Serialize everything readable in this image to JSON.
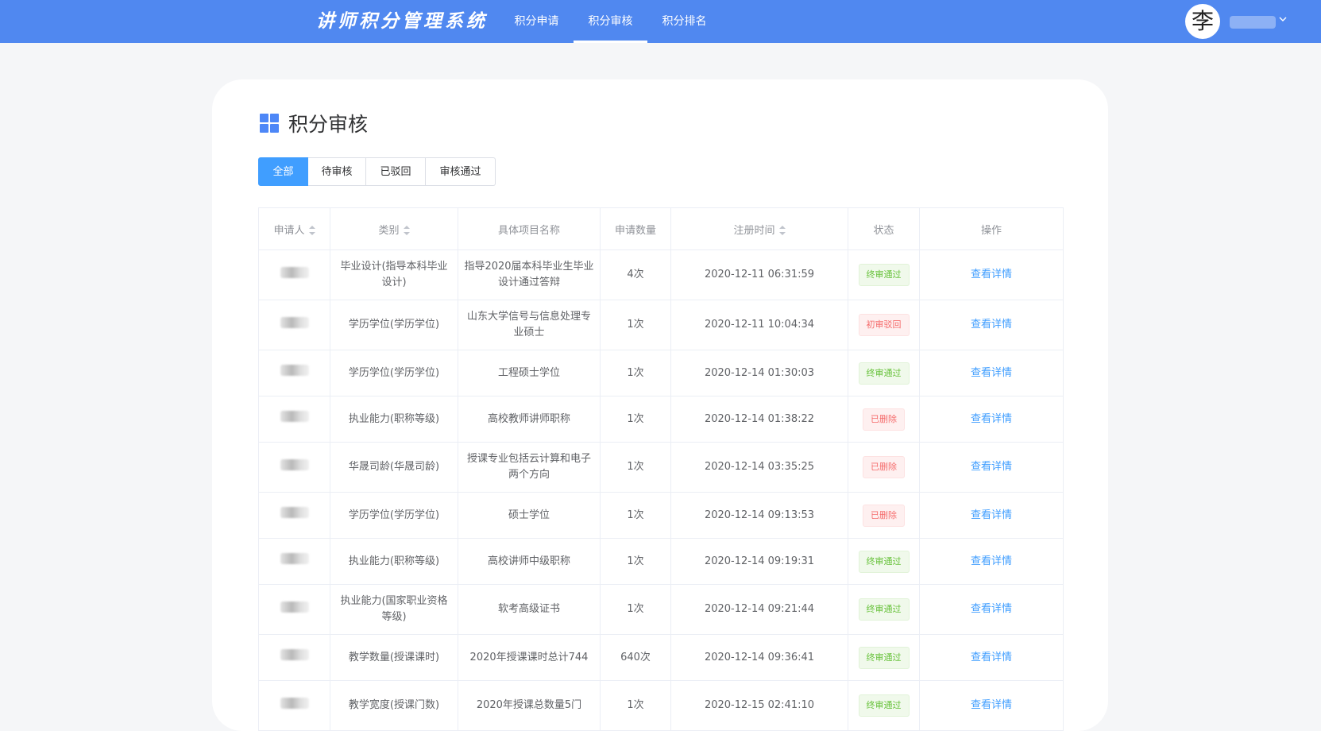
{
  "header": {
    "logo": "讲师积分管理系统",
    "nav": [
      {
        "label": "积分申请",
        "active": false
      },
      {
        "label": "积分审核",
        "active": true
      },
      {
        "label": "积分排名",
        "active": false
      }
    ],
    "avatar": "李",
    "user_menu_icon": "chevron-down-icon"
  },
  "page": {
    "title": "积分审核",
    "title_icon": "grid-icon"
  },
  "tabs": [
    {
      "label": "全部",
      "active": true
    },
    {
      "label": "待审核",
      "active": false
    },
    {
      "label": "已驳回",
      "active": false
    },
    {
      "label": "审核通过",
      "active": false
    }
  ],
  "table": {
    "columns": [
      "申请人",
      "类别",
      "具体项目名称",
      "申请数量",
      "注册时间",
      "状态",
      "操作"
    ],
    "rows": [
      {
        "category": "毕业设计(指导本科毕业设计)",
        "project": "指导2020届本科毕业生毕业设计通过答辩",
        "count": "4次",
        "time": "2020-12-11 06:31:59",
        "status": "终审通过",
        "status_type": "success",
        "action": "查看详情"
      },
      {
        "category": "学历学位(学历学位)",
        "project": "山东大学信号与信息处理专业硕士",
        "count": "1次",
        "time": "2020-12-11 10:04:34",
        "status": "初审驳回",
        "status_type": "danger",
        "action": "查看详情"
      },
      {
        "category": "学历学位(学历学位)",
        "project": "工程硕士学位",
        "count": "1次",
        "time": "2020-12-14 01:30:03",
        "status": "终审通过",
        "status_type": "success",
        "action": "查看详情"
      },
      {
        "category": "执业能力(职称等级)",
        "project": "高校教师讲师职称",
        "count": "1次",
        "time": "2020-12-14 01:38:22",
        "status": "已删除",
        "status_type": "danger",
        "action": "查看详情"
      },
      {
        "category": "华晟司龄(华晟司龄)",
        "project": "授课专业包括云计算和电子两个方向",
        "count": "1次",
        "time": "2020-12-14 03:35:25",
        "status": "已删除",
        "status_type": "danger",
        "action": "查看详情"
      },
      {
        "category": "学历学位(学历学位)",
        "project": "硕士学位",
        "count": "1次",
        "time": "2020-12-14 09:13:53",
        "status": "已删除",
        "status_type": "danger",
        "action": "查看详情"
      },
      {
        "category": "执业能力(职称等级)",
        "project": "高校讲师中级职称",
        "count": "1次",
        "time": "2020-12-14 09:19:31",
        "status": "终审通过",
        "status_type": "success",
        "action": "查看详情"
      },
      {
        "category": "执业能力(国家职业资格等级)",
        "project": "软考高级证书",
        "count": "1次",
        "time": "2020-12-14 09:21:44",
        "status": "终审通过",
        "status_type": "success",
        "action": "查看详情"
      },
      {
        "category": "教学数量(授课课时)",
        "project": "2020年授课课时总计744",
        "count": "640次",
        "time": "2020-12-14 09:36:41",
        "status": "终审通过",
        "status_type": "success",
        "action": "查看详情"
      },
      {
        "category": "教学宽度(授课门数)",
        "project": "2020年授课总数量5门",
        "count": "1次",
        "time": "2020-12-15 02:41:10",
        "status": "终审通过",
        "status_type": "success",
        "action": "查看详情"
      }
    ]
  }
}
